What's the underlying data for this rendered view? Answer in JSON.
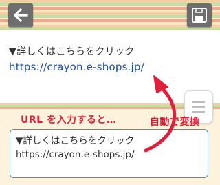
{
  "toolbar": {
    "back_icon": "back-arrow-icon",
    "save_icon": "floppy-disk-icon"
  },
  "preview": {
    "text": "▼詳しくはこちらをクリック",
    "link": "https://crayon.e-shops.jp/"
  },
  "instruction": {
    "left_caption": "URL を入力すると…",
    "right_caption": "自動で変換"
  },
  "editor": {
    "line1": "▼詳しくはこちらをクリック",
    "line2": "https://crayon.e-shops.jp/"
  },
  "colors": {
    "accent_red": "#e0203a",
    "link_blue": "#1f4e9a",
    "input_border": "#5a86b8",
    "button_gray": "#6e6e6e"
  }
}
